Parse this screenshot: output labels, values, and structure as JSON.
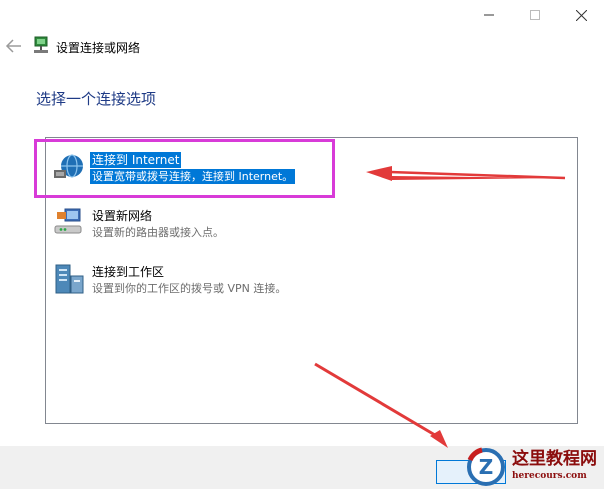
{
  "window": {
    "title": "设置连接或网络",
    "controls": [
      "minimize-icon",
      "maximize-icon",
      "close-icon"
    ]
  },
  "page": {
    "heading": "选择一个连接选项"
  },
  "options": [
    {
      "label": "连接到 Internet",
      "description": "设置宽带或拨号连接，连接到 Internet。",
      "icon": "globe-network-icon",
      "selected": true
    },
    {
      "label": "设置新网络",
      "description": "设置新的路由器或接入点。",
      "icon": "router-setup-icon",
      "selected": false
    },
    {
      "label": "连接到工作区",
      "description": "设置到你的工作区的拨号或 VPN 连接。",
      "icon": "workplace-vpn-icon",
      "selected": false
    }
  ],
  "annotations": {
    "highlight_color": "#d83bd8",
    "arrow_color": "#e23a3a"
  },
  "colors": {
    "selection": "#0078d7",
    "heading": "#1f3b86"
  },
  "watermark": {
    "logo_letter": "Z",
    "title": "这里教程网",
    "url": "herecours.com"
  }
}
